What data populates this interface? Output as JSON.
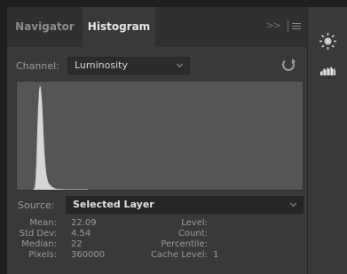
{
  "tabs": {
    "navigator": "Navigator",
    "histogram": "Histogram",
    "collapse": ">>"
  },
  "channel": {
    "label": "Channel:",
    "value": "Luminosity"
  },
  "source": {
    "label": "Source:",
    "value": "Selected Layer"
  },
  "stats_left": [
    {
      "key": "Mean:",
      "value": "22.09"
    },
    {
      "key": "Std Dev:",
      "value": "4.54"
    },
    {
      "key": "Median:",
      "value": "22"
    },
    {
      "key": "Pixels:",
      "value": "360000"
    }
  ],
  "stats_right": [
    {
      "key": "Level:",
      "value": ""
    },
    {
      "key": "Count:",
      "value": ""
    },
    {
      "key": "Percentile:",
      "value": ""
    },
    {
      "key": "Cache Level:",
      "value": "1"
    }
  ],
  "icons": {
    "refresh": "refresh-icon",
    "sun": "brightness-icon",
    "histogram": "histogram-icon",
    "menu": "panel-menu-icon"
  },
  "colors": {
    "panel": "#393939",
    "active_tab": "#393939",
    "graph_bg": "#555555",
    "histogram_fill": "#d6d6d6"
  }
}
